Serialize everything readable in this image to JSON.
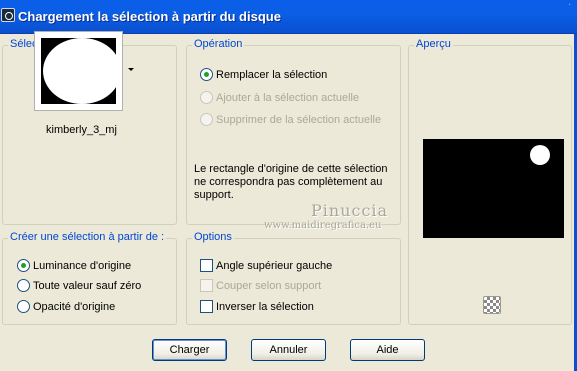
{
  "window": {
    "title": "Chargement la sélection à partir du disque",
    "extra_text": "."
  },
  "groups": {
    "selection": "Sélection",
    "operation": "Opération",
    "preview": "Aperçu",
    "create_from": "Créer une sélection à partir de :",
    "options": "Options"
  },
  "selection": {
    "filename": "kimberly_3_mj"
  },
  "operation": {
    "radios": [
      {
        "label": "Remplacer la sélection",
        "checked": true,
        "enabled": true
      },
      {
        "label": "Ajouter à la sélection actuelle",
        "checked": false,
        "enabled": false
      },
      {
        "label": "Supprimer de la sélection actuelle",
        "checked": false,
        "enabled": false
      }
    ],
    "note": "Le rectangle d'origine de cette sélection ne correspondra pas complètement au support."
  },
  "create_from": {
    "radios": [
      {
        "label": "Luminance d'origine",
        "checked": true
      },
      {
        "label": "Toute valeur sauf zéro",
        "checked": false
      },
      {
        "label": "Opacité d'origine",
        "checked": false
      }
    ]
  },
  "options": {
    "checkboxes": [
      {
        "label": "Angle supérieur gauche",
        "checked": false,
        "enabled": true
      },
      {
        "label": "Couper selon support",
        "checked": false,
        "enabled": false
      },
      {
        "label": "Inverser la sélection",
        "checked": false,
        "enabled": true
      }
    ]
  },
  "watermark": {
    "name": "Pinuccia",
    "url": "www.maidiregrafica.eu"
  },
  "buttons": {
    "ok": "Charger",
    "cancel": "Annuler",
    "help": "Aide"
  },
  "icons": {
    "app": "psp-app-icon",
    "dropdown": "dropdown-arrow-icon",
    "checker": "checkerboard-icon"
  }
}
